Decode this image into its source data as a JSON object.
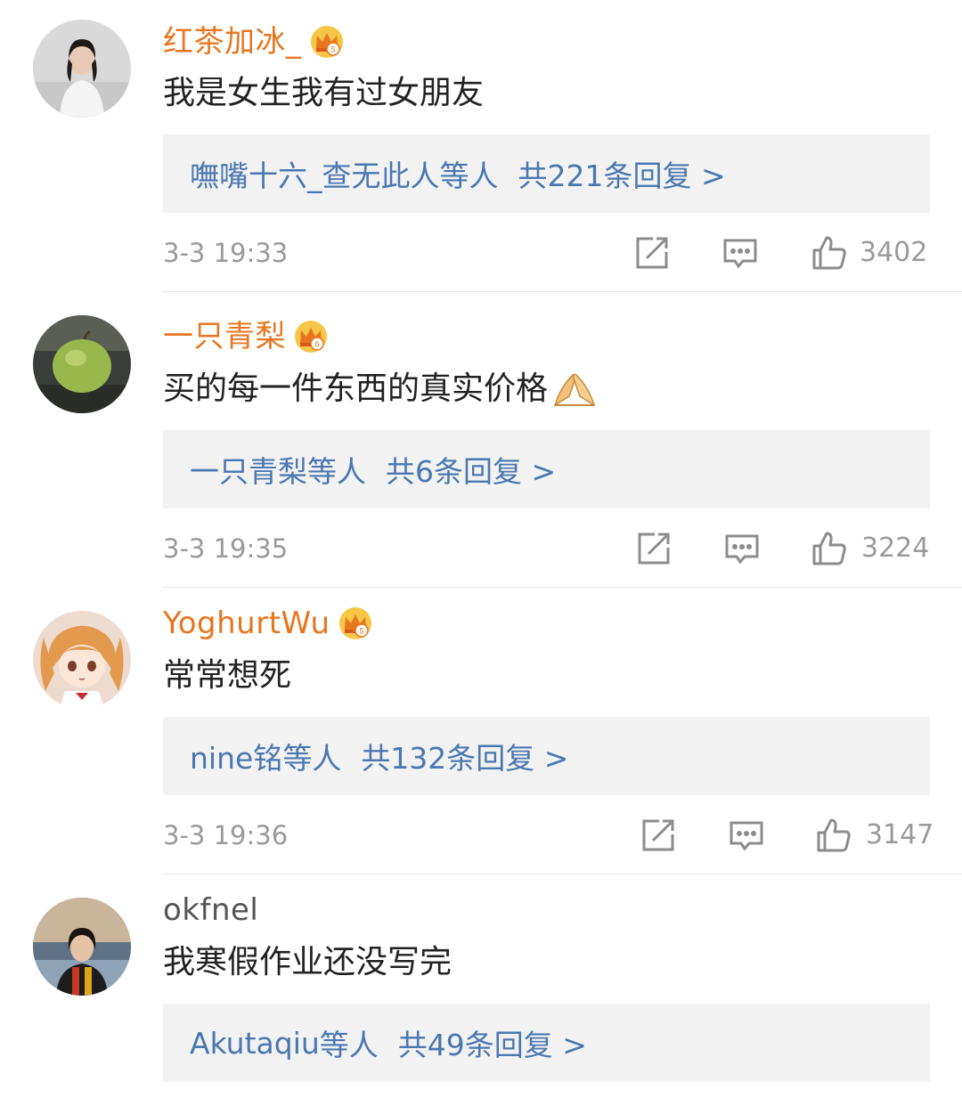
{
  "comments": [
    {
      "username": "红茶加冰_",
      "vip": true,
      "text": "我是女生我有过女朋友",
      "reply_users": "嘸嘴十六_查无此人",
      "reply_etc": "等人",
      "reply_count": "共221条回复 >",
      "timestamp": "3-3 19:33",
      "likes": "3402"
    },
    {
      "username": "一只青梨",
      "vip": true,
      "text": "买的每一件东西的真实价格",
      "emoji": "pray-hands-emoji",
      "reply_users": "一只青梨",
      "reply_etc": "等人",
      "reply_count": "共6条回复 >",
      "timestamp": "3-3 19:35",
      "likes": "3224"
    },
    {
      "username": "YoghurtWu",
      "vip": true,
      "text": "常常想死",
      "reply_users": "nine铭",
      "reply_etc": "等人",
      "reply_count": "共132条回复 >",
      "timestamp": "3-3 19:36",
      "likes": "3147"
    },
    {
      "username": "okfnel",
      "vip": false,
      "text": "我寒假作业还没写完",
      "reply_users": "Akutaqiu",
      "reply_etc": "等人",
      "reply_count": "共49条回复 >",
      "timestamp": "",
      "likes": ""
    }
  ],
  "icons": {
    "repost": "repost-icon",
    "comment": "comment-icon",
    "like": "like-icon",
    "vip": "crown-vip-icon"
  },
  "colors": {
    "vip_name": "#e8761f",
    "normal_name": "#555555",
    "reply_link": "#4a77b0",
    "reply_bg": "#f2f2f2",
    "meta_text": "#9a9a9a",
    "body_text": "#222222"
  }
}
